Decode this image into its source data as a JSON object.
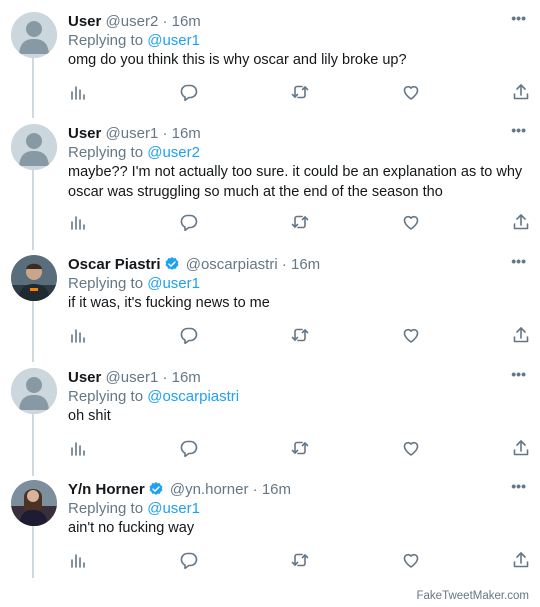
{
  "footer": {
    "watermark": "FakeTweetMaker.com"
  },
  "colors": {
    "link": "#1da1f2",
    "muted": "#657786",
    "verified": "#1da1f2"
  },
  "tweets": [
    {
      "name": "User",
      "handle": "@user2",
      "time": "16m",
      "verified": false,
      "replying_prefix": "Replying to",
      "replying_to": "@user1",
      "text": "omg do you think this is why oscar and lily broke up?"
    },
    {
      "name": "User",
      "handle": "@user1",
      "time": "16m",
      "verified": false,
      "replying_prefix": "Replying to",
      "replying_to": "@user2",
      "text": "maybe?? I'm not actually too sure. it could be an explanation as to why oscar was struggling so much at the end of the season tho"
    },
    {
      "name": "Oscar Piastri",
      "handle": "@oscarpiastri",
      "time": "16m",
      "verified": true,
      "replying_prefix": "Replying to",
      "replying_to": "@user1",
      "text": "if it was, it's fucking news to me"
    },
    {
      "name": "User",
      "handle": "@user1",
      "time": "16m",
      "verified": false,
      "replying_prefix": "Replying to",
      "replying_to": "@oscarpiastri",
      "text": "oh shit"
    },
    {
      "name": "Y/n Horner",
      "handle": "@yn.horner",
      "time": "16m",
      "verified": true,
      "replying_prefix": "Replying to",
      "replying_to": "@user1",
      "text": "ain't no fucking way"
    }
  ],
  "separator": "·",
  "more_glyph": "•••"
}
